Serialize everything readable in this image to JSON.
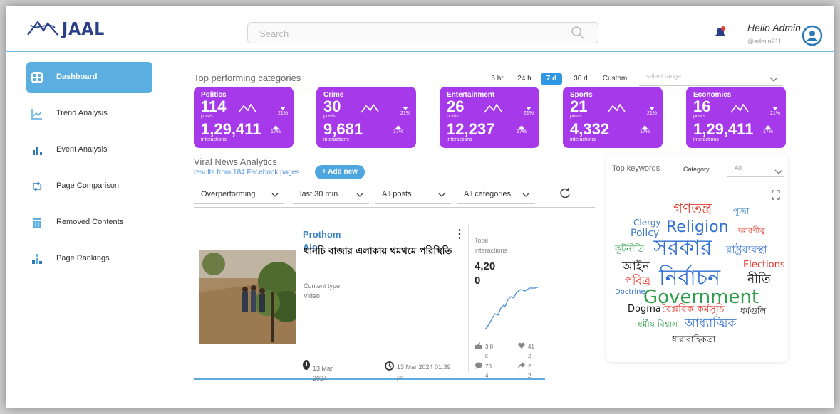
{
  "header": {
    "logo_text": "JAAL",
    "search_placeholder": "Search",
    "greeting": "Hello Admin",
    "handle": "@admin211"
  },
  "sidebar": {
    "items": [
      {
        "label": "Dashboard",
        "icon": "dashboard-icon",
        "active": true
      },
      {
        "label": "Trend Analysis",
        "icon": "trend-chart-icon",
        "active": false
      },
      {
        "label": "Event Analysis",
        "icon": "bar-chart-icon",
        "active": false
      },
      {
        "label": "Page Comparison",
        "icon": "compare-icon",
        "active": false
      },
      {
        "label": "Removed Contents",
        "icon": "trash-icon",
        "active": false
      },
      {
        "label": "Page Rankings",
        "icon": "ranking-icon",
        "active": false
      }
    ]
  },
  "top_categories": {
    "title": "Top performing categories",
    "ranges": [
      "6 hr",
      "24 h",
      "7 d",
      "30 d",
      "Custom"
    ],
    "active_range": "7 d",
    "select_range_placeholder": "select range",
    "cards": [
      {
        "category": "Politics",
        "posts": "114",
        "posts_label": "posts",
        "posts_pct": "21%",
        "interactions": "1,29,411",
        "interactions_label": "interactions",
        "interactions_pct": "17%"
      },
      {
        "category": "Crime",
        "posts": "30",
        "posts_label": "posts",
        "posts_pct": "21%",
        "interactions": "9,681",
        "interactions_label": "interactions",
        "interactions_pct": "17%"
      },
      {
        "category": "Entertainment",
        "posts": "26",
        "posts_label": "posts",
        "posts_pct": "21%",
        "interactions": "12,237",
        "interactions_label": "interactions",
        "interactions_pct": "17%"
      },
      {
        "category": "Sports",
        "posts": "21",
        "posts_label": "posts",
        "posts_pct": "21%",
        "interactions": "4,332",
        "interactions_label": "interactions",
        "interactions_pct": "17%"
      },
      {
        "category": "Economics",
        "posts": "16",
        "posts_label": "posts",
        "posts_pct": "21%",
        "interactions": "1,29,411",
        "interactions_label": "interactions",
        "interactions_pct": "17%"
      }
    ],
    "card_color": "#a63aeb"
  },
  "viral": {
    "title": "Viral News Analytics",
    "subtitle": "results from 184 Facebook pages",
    "add_button": "+ Add new",
    "filters": [
      "Overperforming",
      "last 30 min",
      "All posts",
      "All categories"
    ],
    "post": {
      "publisher_line1": "Prothom",
      "publisher_line2": "Alo",
      "headline": "থানচি বাজার এলাকায় থমথমে পরিস্থিতি",
      "content_type_label": "Content type:",
      "content_type": "Video",
      "date1_line1": "13 Mar",
      "date1_line2": "2024",
      "date2_line1": "13 Mar 2024 01:39",
      "date2_line2": "pm",
      "total_label_line1": "Total",
      "total_label_line2": "interactions",
      "total_value_line1": "4,20",
      "total_value_line2": "0",
      "likes_line1": "3.8",
      "likes_line2": "k",
      "loves_line1": "41",
      "loves_line2": "2",
      "comments_line1": "73",
      "comments_line2": "4",
      "shares_line1": "2",
      "shares_line2": "2"
    }
  },
  "keywords": {
    "title": "Top keywords",
    "category_label": "Category",
    "category_value": "All",
    "words": [
      {
        "text": "গণতন্ত্র",
        "color": "#e23b2e"
      },
      {
        "text": "পূজা",
        "color": "#2a7ab8"
      },
      {
        "text": "Clergy",
        "color": "#3d79c4"
      },
      {
        "text": "Policy",
        "color": "#3d79c4"
      },
      {
        "text": "Religion",
        "color": "#2f6fd1"
      },
      {
        "text": "দলবণীত্ব",
        "color": "#e23b2e"
      },
      {
        "text": "কূটনীতি",
        "color": "#2e9e4a"
      },
      {
        "text": "সরকার",
        "color": "#2f6fd1"
      },
      {
        "text": "রাষ্ট্রব্যবস্থা",
        "color": "#2f6fd1"
      },
      {
        "text": "আইন",
        "color": "#111111"
      },
      {
        "text": "Elections",
        "color": "#e23b2e"
      },
      {
        "text": "পবিত্র",
        "color": "#e23b2e"
      },
      {
        "text": "নির্বাচন",
        "color": "#2f6fd1"
      },
      {
        "text": "নীতি",
        "color": "#111111"
      },
      {
        "text": "Doctrine",
        "color": "#2f6fd1"
      },
      {
        "text": "Government",
        "color": "#2e9e4a"
      },
      {
        "text": "Dogma",
        "color": "#111111"
      },
      {
        "text": "বৈপ্লবিক কর্মসূচি",
        "color": "#e23b2e"
      },
      {
        "text": "ধর্মগুলি",
        "color": "#111111"
      },
      {
        "text": "ধর্মীয় বিশ্বাস",
        "color": "#2e9e4a"
      },
      {
        "text": "আধ্যাত্মিক",
        "color": "#2f6fd1"
      },
      {
        "text": "ধারাবাহিকতা",
        "color": "#111111"
      }
    ]
  },
  "colors": {
    "accent": "#5aaee0",
    "brand": "#2a3f8a"
  }
}
